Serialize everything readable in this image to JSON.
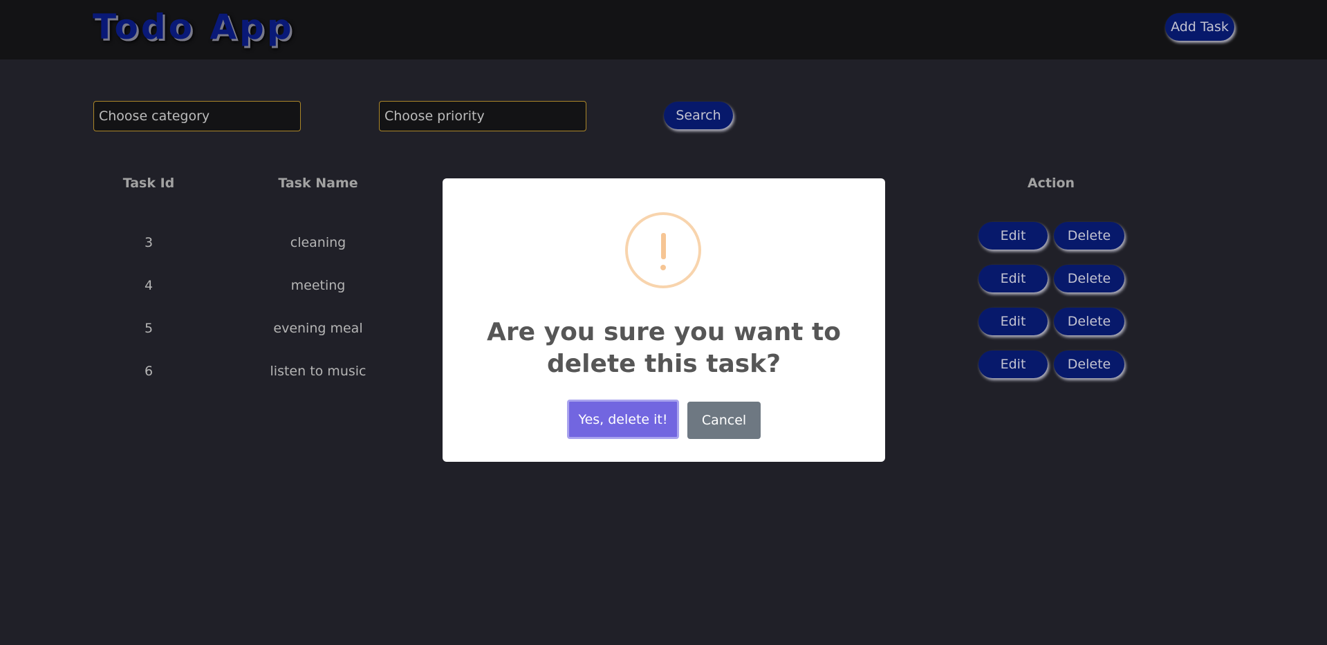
{
  "header": {
    "logo": "Todo App",
    "add_task_label": "Add Task"
  },
  "filters": {
    "category_placeholder": "Choose category",
    "priority_placeholder": "Choose priority",
    "search_label": "Search"
  },
  "table": {
    "headers": {
      "task_id": "Task Id",
      "task_name": "Task Name",
      "action": "Action"
    },
    "rows": [
      {
        "id": "3",
        "name": "cleaning"
      },
      {
        "id": "4",
        "name": "meeting"
      },
      {
        "id": "5",
        "name": "evening meal"
      },
      {
        "id": "6",
        "name": "listen to music"
      }
    ],
    "edit_label": "Edit",
    "delete_label": "Delete"
  },
  "modal": {
    "icon": "warning-icon",
    "title": "Are you sure you want to delete this task?",
    "confirm_label": "Yes, delete it!",
    "cancel_label": "Cancel"
  },
  "colors": {
    "background": "#212129",
    "header": "#141416",
    "button": "#081a6e",
    "confirm": "#7266e0",
    "cancel": "#6e7882",
    "warning": "#f6c594"
  }
}
